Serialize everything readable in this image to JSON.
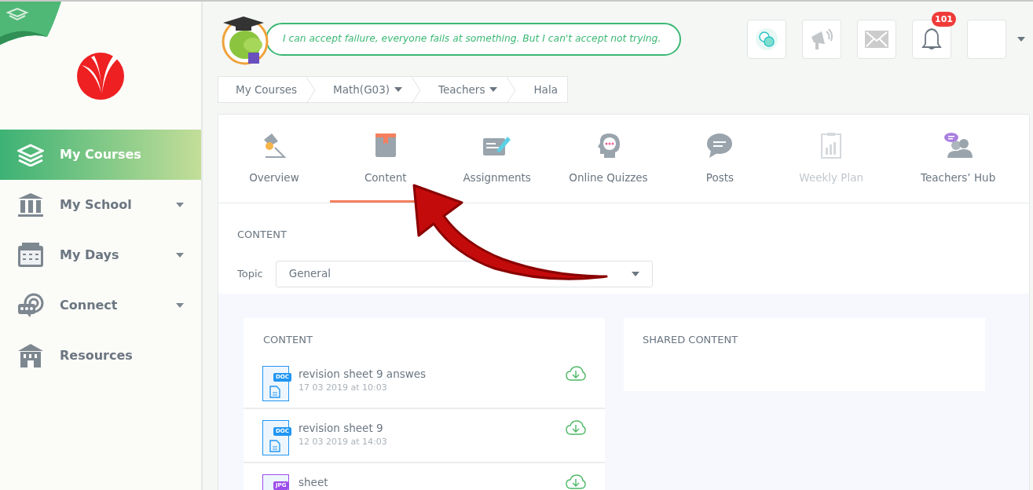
{
  "sidebar": {
    "items": [
      {
        "label": "My Courses",
        "selected": true,
        "has_menu": false
      },
      {
        "label": "My School",
        "selected": false,
        "has_menu": true
      },
      {
        "label": "My Days",
        "selected": false,
        "has_menu": true
      },
      {
        "label": "Connect",
        "selected": false,
        "has_menu": true
      },
      {
        "label": "Resources",
        "selected": false,
        "has_menu": false
      }
    ]
  },
  "quote": "I can accept failure, everyone fails at something. But I can't accept not trying.",
  "toolbar": {
    "notifications_badge": "101"
  },
  "breadcrumb": [
    {
      "label": "My Courses",
      "has_menu": false
    },
    {
      "label": "Math(G03)",
      "has_menu": true
    },
    {
      "label": "Teachers",
      "has_menu": true
    },
    {
      "label": "Hala",
      "has_menu": false
    }
  ],
  "tabs": [
    {
      "label": "Overview",
      "selected": false,
      "disabled": false
    },
    {
      "label": "Content",
      "selected": true,
      "disabled": false
    },
    {
      "label": "Assignments",
      "selected": false,
      "disabled": false
    },
    {
      "label": "Online Quizzes",
      "selected": false,
      "disabled": false
    },
    {
      "label": "Posts",
      "selected": false,
      "disabled": false
    },
    {
      "label": "Weekly Plan",
      "selected": false,
      "disabled": true
    },
    {
      "label": "Teachers’ Hub",
      "selected": false,
      "disabled": false
    }
  ],
  "content_section": {
    "title": "CONTENT",
    "topic_label": "Topic",
    "topic_value": "General"
  },
  "content_panel": {
    "title": "CONTENT",
    "files": [
      {
        "name": "revision sheet 9 answes",
        "date": "17 03 2019 at 10:03",
        "type_label": "DOC",
        "color": "#2196f3"
      },
      {
        "name": "revision sheet 9",
        "date": "12 03 2019 at 14:03",
        "type_label": "DOC",
        "color": "#2196f3"
      },
      {
        "name": "sheet",
        "type_label": "JPG",
        "color": "#9c4dea"
      }
    ]
  },
  "shared_panel": {
    "title": "SHARED CONTENT"
  }
}
